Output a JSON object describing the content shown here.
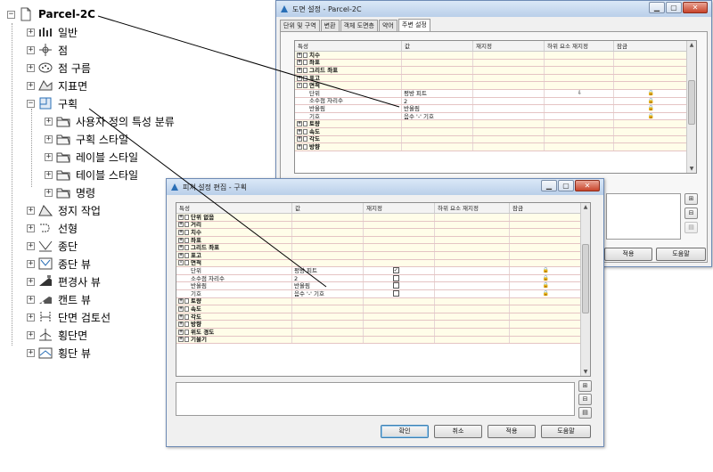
{
  "tree": {
    "root": {
      "label": "Parcel-2C",
      "icon": "document-icon"
    },
    "items": [
      {
        "label": "일반",
        "icon": "styles-icon",
        "level": 1
      },
      {
        "label": "점",
        "icon": "point-icon",
        "level": 1
      },
      {
        "label": "점 구름",
        "icon": "point-cloud-icon",
        "level": 1
      },
      {
        "label": "지표면",
        "icon": "surface-icon",
        "level": 1
      },
      {
        "label": "구획",
        "icon": "parcel-icon",
        "level": 1,
        "expanded": true
      },
      {
        "label": "사용자 정의 특성 분류",
        "icon": "folder-icon",
        "level": 2
      },
      {
        "label": "구획 스타일",
        "icon": "folder-icon",
        "level": 2
      },
      {
        "label": "레이블 스타일",
        "icon": "folder-icon",
        "level": 2
      },
      {
        "label": "테이블 스타일",
        "icon": "folder-icon",
        "level": 2
      },
      {
        "label": "명령",
        "icon": "folder-icon",
        "level": 2
      },
      {
        "label": "정지 작업",
        "icon": "grading-icon",
        "level": 1
      },
      {
        "label": "선형",
        "icon": "alignment-icon",
        "level": 1
      },
      {
        "label": "종단",
        "icon": "profile-icon",
        "level": 1
      },
      {
        "label": "종단 뷰",
        "icon": "profile-view-icon",
        "level": 1
      },
      {
        "label": "편경사 뷰",
        "icon": "superelevation-view-icon",
        "level": 1
      },
      {
        "label": "캔트 뷰",
        "icon": "cant-view-icon",
        "level": 1
      },
      {
        "label": "단면 검토선",
        "icon": "sample-line-icon",
        "level": 1
      },
      {
        "label": "횡단면",
        "icon": "section-icon",
        "level": 1
      },
      {
        "label": "횡단 뷰",
        "icon": "section-view-icon",
        "level": 1
      }
    ]
  },
  "win1": {
    "title": "도면 설정 - Parcel-2C",
    "tabs": [
      "단위 및 구역",
      "변환",
      "객체 도면층",
      "약어",
      "주변 설정"
    ],
    "active_tab": 4,
    "columns": [
      "특성",
      "값",
      "재지정",
      "하위 요소 재지정",
      "잠금"
    ],
    "rows": [
      {
        "type": "cat",
        "sign": "+",
        "name": "치수"
      },
      {
        "type": "cat",
        "sign": "+",
        "name": "좌표"
      },
      {
        "type": "cat",
        "sign": "+",
        "name": "그리드 좌표"
      },
      {
        "type": "cat",
        "sign": "+",
        "name": "표고"
      },
      {
        "type": "cat",
        "sign": "-",
        "name": "면적"
      },
      {
        "type": "prop",
        "name": "단위",
        "value": "평방 피트",
        "sub": "⇩",
        "lock": "🔒"
      },
      {
        "type": "prop",
        "name": "소수점 자리수",
        "value": "2",
        "lock": "🔒"
      },
      {
        "type": "prop",
        "name": "반올림",
        "value": "반올림",
        "lock": "🔒"
      },
      {
        "type": "prop",
        "name": "기호",
        "value": "음수 '-' 기호",
        "lock": "🔒"
      },
      {
        "type": "cat",
        "sign": "+",
        "name": "토량"
      },
      {
        "type": "cat",
        "sign": "+",
        "name": "속도"
      },
      {
        "type": "cat",
        "sign": "+",
        "name": "각도"
      },
      {
        "type": "cat",
        "sign": "+",
        "name": "방향"
      }
    ],
    "buttons": {
      "apply": "적용",
      "help": "도움말"
    }
  },
  "win2": {
    "title": "피쳐 설정 편집 - 구획",
    "columns": [
      "특성",
      "값",
      "재지정",
      "하위 요소 재지정",
      "잠금"
    ],
    "rows": [
      {
        "type": "cat",
        "sign": "+",
        "name": "단위 없음"
      },
      {
        "type": "cat",
        "sign": "+",
        "name": "거리"
      },
      {
        "type": "cat",
        "sign": "+",
        "name": "치수"
      },
      {
        "type": "cat",
        "sign": "+",
        "name": "좌표"
      },
      {
        "type": "cat",
        "sign": "+",
        "name": "그리드 좌표"
      },
      {
        "type": "cat",
        "sign": "+",
        "name": "표고"
      },
      {
        "type": "cat",
        "sign": "-",
        "name": "면적"
      },
      {
        "type": "prop",
        "name": "단위",
        "value": "평방 피트",
        "check": true,
        "lock": "🔒"
      },
      {
        "type": "prop",
        "name": "소수점 자리수",
        "value": "2",
        "check": false,
        "lock": "🔒"
      },
      {
        "type": "prop",
        "name": "반올림",
        "value": "반올림",
        "check": false,
        "lock": "🔒"
      },
      {
        "type": "prop",
        "name": "기호",
        "value": "음수 '-' 기호",
        "check": false,
        "lock": "🔒"
      },
      {
        "type": "cat",
        "sign": "+",
        "name": "토량"
      },
      {
        "type": "cat",
        "sign": "+",
        "name": "속도"
      },
      {
        "type": "cat",
        "sign": "+",
        "name": "각도"
      },
      {
        "type": "cat",
        "sign": "+",
        "name": "방향"
      },
      {
        "type": "cat",
        "sign": "+",
        "name": "위도 경도"
      },
      {
        "type": "cat",
        "sign": "+",
        "name": "기울기"
      }
    ],
    "buttons": {
      "ok": "확인",
      "cancel": "취소",
      "apply": "적용",
      "help": "도움말"
    }
  },
  "colors": {
    "accent": "#3c7fb1",
    "category_bg": "#fffde9",
    "row_line": "#e5c4c4"
  }
}
